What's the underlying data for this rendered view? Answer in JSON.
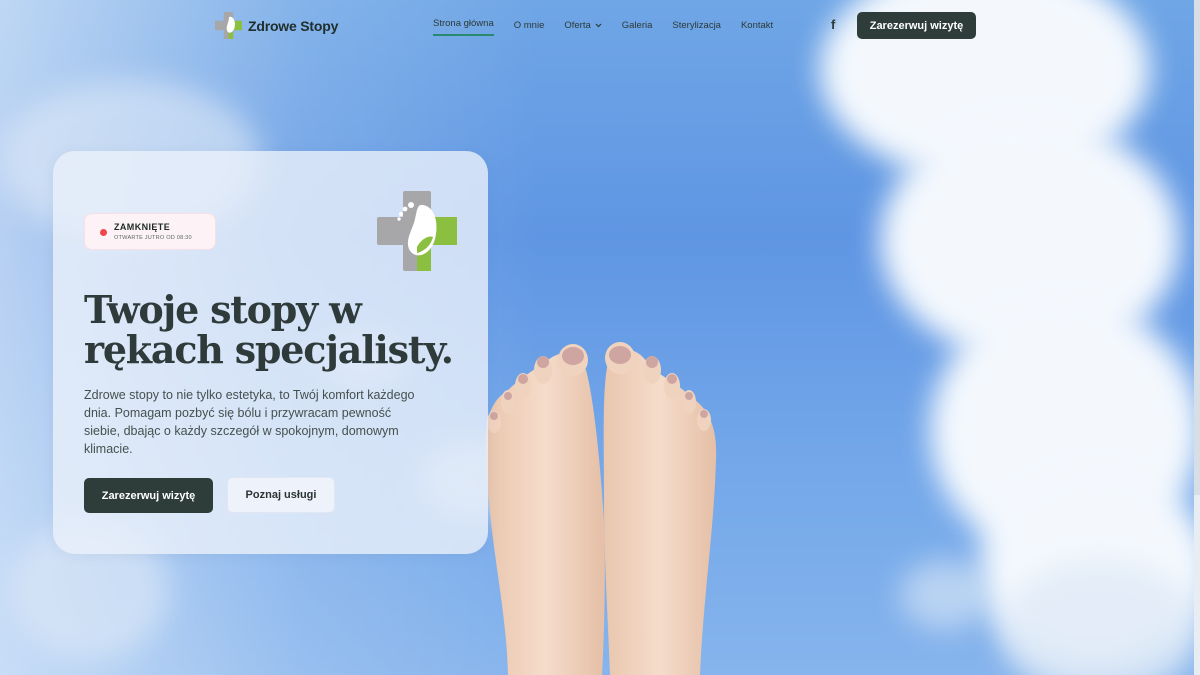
{
  "brand": {
    "name": "Zdrowe Stopy"
  },
  "nav": {
    "items": [
      {
        "label": "Strona główna",
        "active": true
      },
      {
        "label": "O mnie"
      },
      {
        "label": "Oferta",
        "has_dropdown": true
      },
      {
        "label": "Galeria"
      },
      {
        "label": "Sterylizacja"
      },
      {
        "label": "Kontakt"
      }
    ],
    "cta_label": "Zarezerwuj wizytę",
    "social_icon": "facebook-icon"
  },
  "hero": {
    "status": {
      "title": "ZAMKNIĘTE",
      "subtitle": "OTWARTE JUTRO OD 08:30"
    },
    "headline": "Twoje stopy w rękach specjalisty.",
    "description": "Zdrowe stopy to nie tylko estetyka, to Twój komfort każdego dnia. Pomagam pozbyć się bólu i przywracam pewność siebie, dbając o każdy szczegół w spokojnym, domowym klimacie.",
    "primary_button": "Zarezerwuj wizytę",
    "secondary_button": "Poznaj usługi"
  },
  "colors": {
    "accent_dark": "#2e3d3a",
    "accent_green": "#8bbf3f",
    "logo_gray": "#a7a6a8",
    "status_red": "#f0474b"
  }
}
